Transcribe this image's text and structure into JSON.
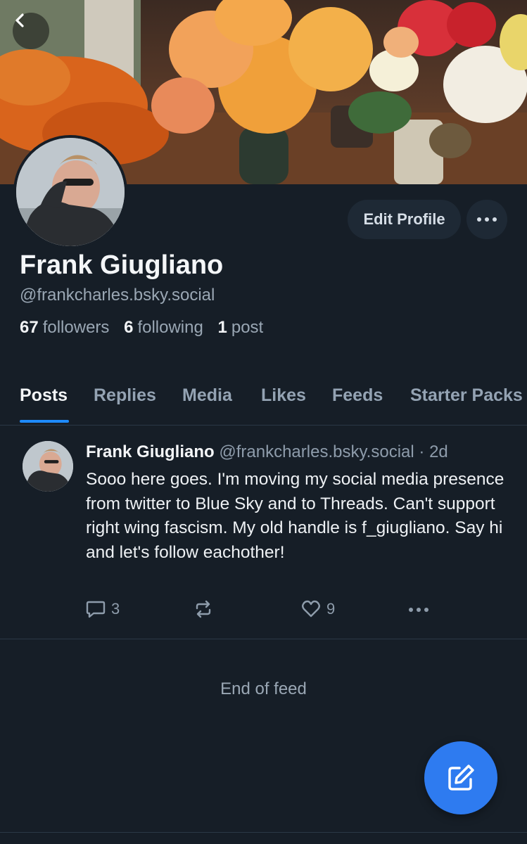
{
  "nav": {
    "back_icon": "chevron-left-icon"
  },
  "profile": {
    "display_name": "Frank Giugliano",
    "handle": "@frankcharles.bsky.social",
    "followers_count": "67",
    "followers_label": "followers",
    "following_count": "6",
    "following_label": "following",
    "posts_count": "1",
    "posts_label": "post",
    "edit_label": "Edit Profile",
    "more_icon": "ellipsis-icon"
  },
  "tabs": [
    {
      "label": "Posts",
      "active": true
    },
    {
      "label": "Replies"
    },
    {
      "label": "Media"
    },
    {
      "label": "Likes"
    },
    {
      "label": "Feeds"
    },
    {
      "label": "Starter Packs"
    }
  ],
  "post": {
    "author": "Frank Giugliano",
    "handle": "@frankcharles.bsky.social",
    "separator": "·",
    "time": "2d",
    "text": "Sooo here goes. I'm moving my social media presence from twitter to Blue Sky and to Threads. Can't support right wing fascism. My old handle is f_giugliano. Say hi and let's follow eachother!",
    "reply_count": "3",
    "repost_count": "",
    "like_count": "9"
  },
  "feed": {
    "end_text": "End of feed"
  },
  "colors": {
    "accent": "#1e8bff",
    "fab": "#2e7bf0",
    "background": "#161e27"
  },
  "fab": {
    "icon": "compose-icon"
  }
}
